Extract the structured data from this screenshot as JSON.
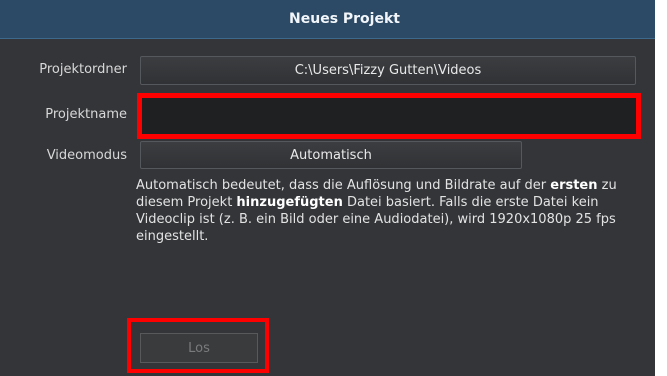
{
  "dialog": {
    "title": "Neues Projekt"
  },
  "fields": {
    "folder_label": "Projektordner",
    "folder_value": "C:\\Users\\Fizzy Gutten\\Videos",
    "name_label": "Projektname",
    "name_value": "",
    "mode_label": "Videomodus",
    "mode_value": "Automatisch"
  },
  "description": {
    "part1": "Automatisch bedeutet, dass die Auflösung und Bildrate auf der ",
    "bold1": "ersten",
    "part2": " zu diesem Projekt ",
    "bold2": "hinzugefügten",
    "part3": " Datei basiert. Falls die erste Datei kein Videoclip ist (z. B. ein Bild oder eine Audiodatei), wird 1920x1080p 25 fps eingestellt."
  },
  "actions": {
    "go_label": "Los"
  },
  "colors": {
    "title_bar": "#2c4a66",
    "dialog_bg": "#333538",
    "highlight": "#ff0000"
  }
}
